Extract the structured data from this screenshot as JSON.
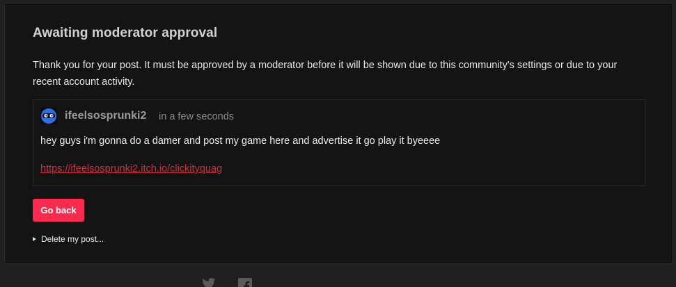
{
  "notice": {
    "title": "Awaiting moderator approval",
    "message": "Thank you for your post. It must be approved by a moderator before it will be shown due to this community's settings or due to your recent account activity."
  },
  "post": {
    "avatar_icon": "avatar-icon",
    "username": "ifeelsosprunki2",
    "timestamp": "in a few seconds",
    "body": "hey guys i'm gonna do a damer and post my game here and advertise it go play it byeeee",
    "link": "https://ifeelsosprunki2.itch.io/clickityquag"
  },
  "actions": {
    "go_back_label": "Go back",
    "delete_label": "Delete my post..."
  },
  "footer": {
    "icons": [
      "twitter-icon",
      "facebook-icon"
    ]
  },
  "colors": {
    "accent": "#fa2b4f",
    "link": "#c8323f",
    "background": "#202020",
    "card": "#141414"
  }
}
